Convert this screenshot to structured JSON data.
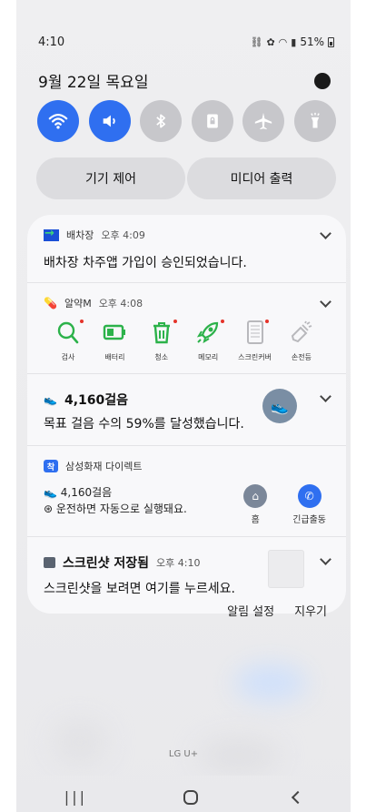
{
  "status_bar": {
    "time": "4:10",
    "battery": "51%"
  },
  "header": {
    "date": "9월 22일 목요일"
  },
  "quick_toggles": [
    {
      "name": "wifi-toggle",
      "icon": "wifi-icon",
      "state": "on"
    },
    {
      "name": "sound-toggle",
      "icon": "speaker-icon",
      "state": "on"
    },
    {
      "name": "bluetooth-toggle",
      "icon": "bluetooth-icon",
      "state": "off"
    },
    {
      "name": "rotation-lock-toggle",
      "icon": "lock-rotation-icon",
      "state": "off"
    },
    {
      "name": "airplane-toggle",
      "icon": "airplane-icon",
      "state": "off"
    },
    {
      "name": "flashlight-toggle",
      "icon": "flashlight-icon",
      "state": "off"
    }
  ],
  "panel_buttons": {
    "device_control": "기기 제어",
    "media_output": "미디어 출력"
  },
  "notifications": {
    "baechajang": {
      "app": "배차장",
      "time": "오후 4:09",
      "message": "배차장 차주앱 가입이 승인되었습니다."
    },
    "alyak": {
      "app": "알약M",
      "time": "오후 4:08",
      "items": [
        {
          "label": "검사",
          "icon": "search-icon"
        },
        {
          "label": "배터리",
          "icon": "battery-icon"
        },
        {
          "label": "청소",
          "icon": "trash-icon"
        },
        {
          "label": "메모리",
          "icon": "rocket-icon"
        },
        {
          "label": "스크린커버",
          "icon": "screen-cover-icon"
        },
        {
          "label": "손전등",
          "icon": "flashlight-icon"
        }
      ]
    },
    "steps": {
      "title": "4,160걸음",
      "message": "목표 걸음 수의 59%를 달성했습니다."
    },
    "samsung_direct": {
      "app": "삼성화재 다이렉트",
      "steps": "4,160걸음",
      "driving": "운전하면 자동으로 실행돼요.",
      "home_label": "홈",
      "emergency_label": "긴급출동"
    },
    "screenshot": {
      "title": "스크린샷 저장됨",
      "time": "오후 4:10",
      "message": "스크린샷을 보려면 여기를 누르세요."
    }
  },
  "footer": {
    "notification_settings": "알림 설정",
    "clear": "지우기",
    "carrier": "LG U+"
  },
  "colors": {
    "accent": "#2f6ff0",
    "toggle_off": "#c7c7cb",
    "alyak_green": "#2cb24a"
  }
}
